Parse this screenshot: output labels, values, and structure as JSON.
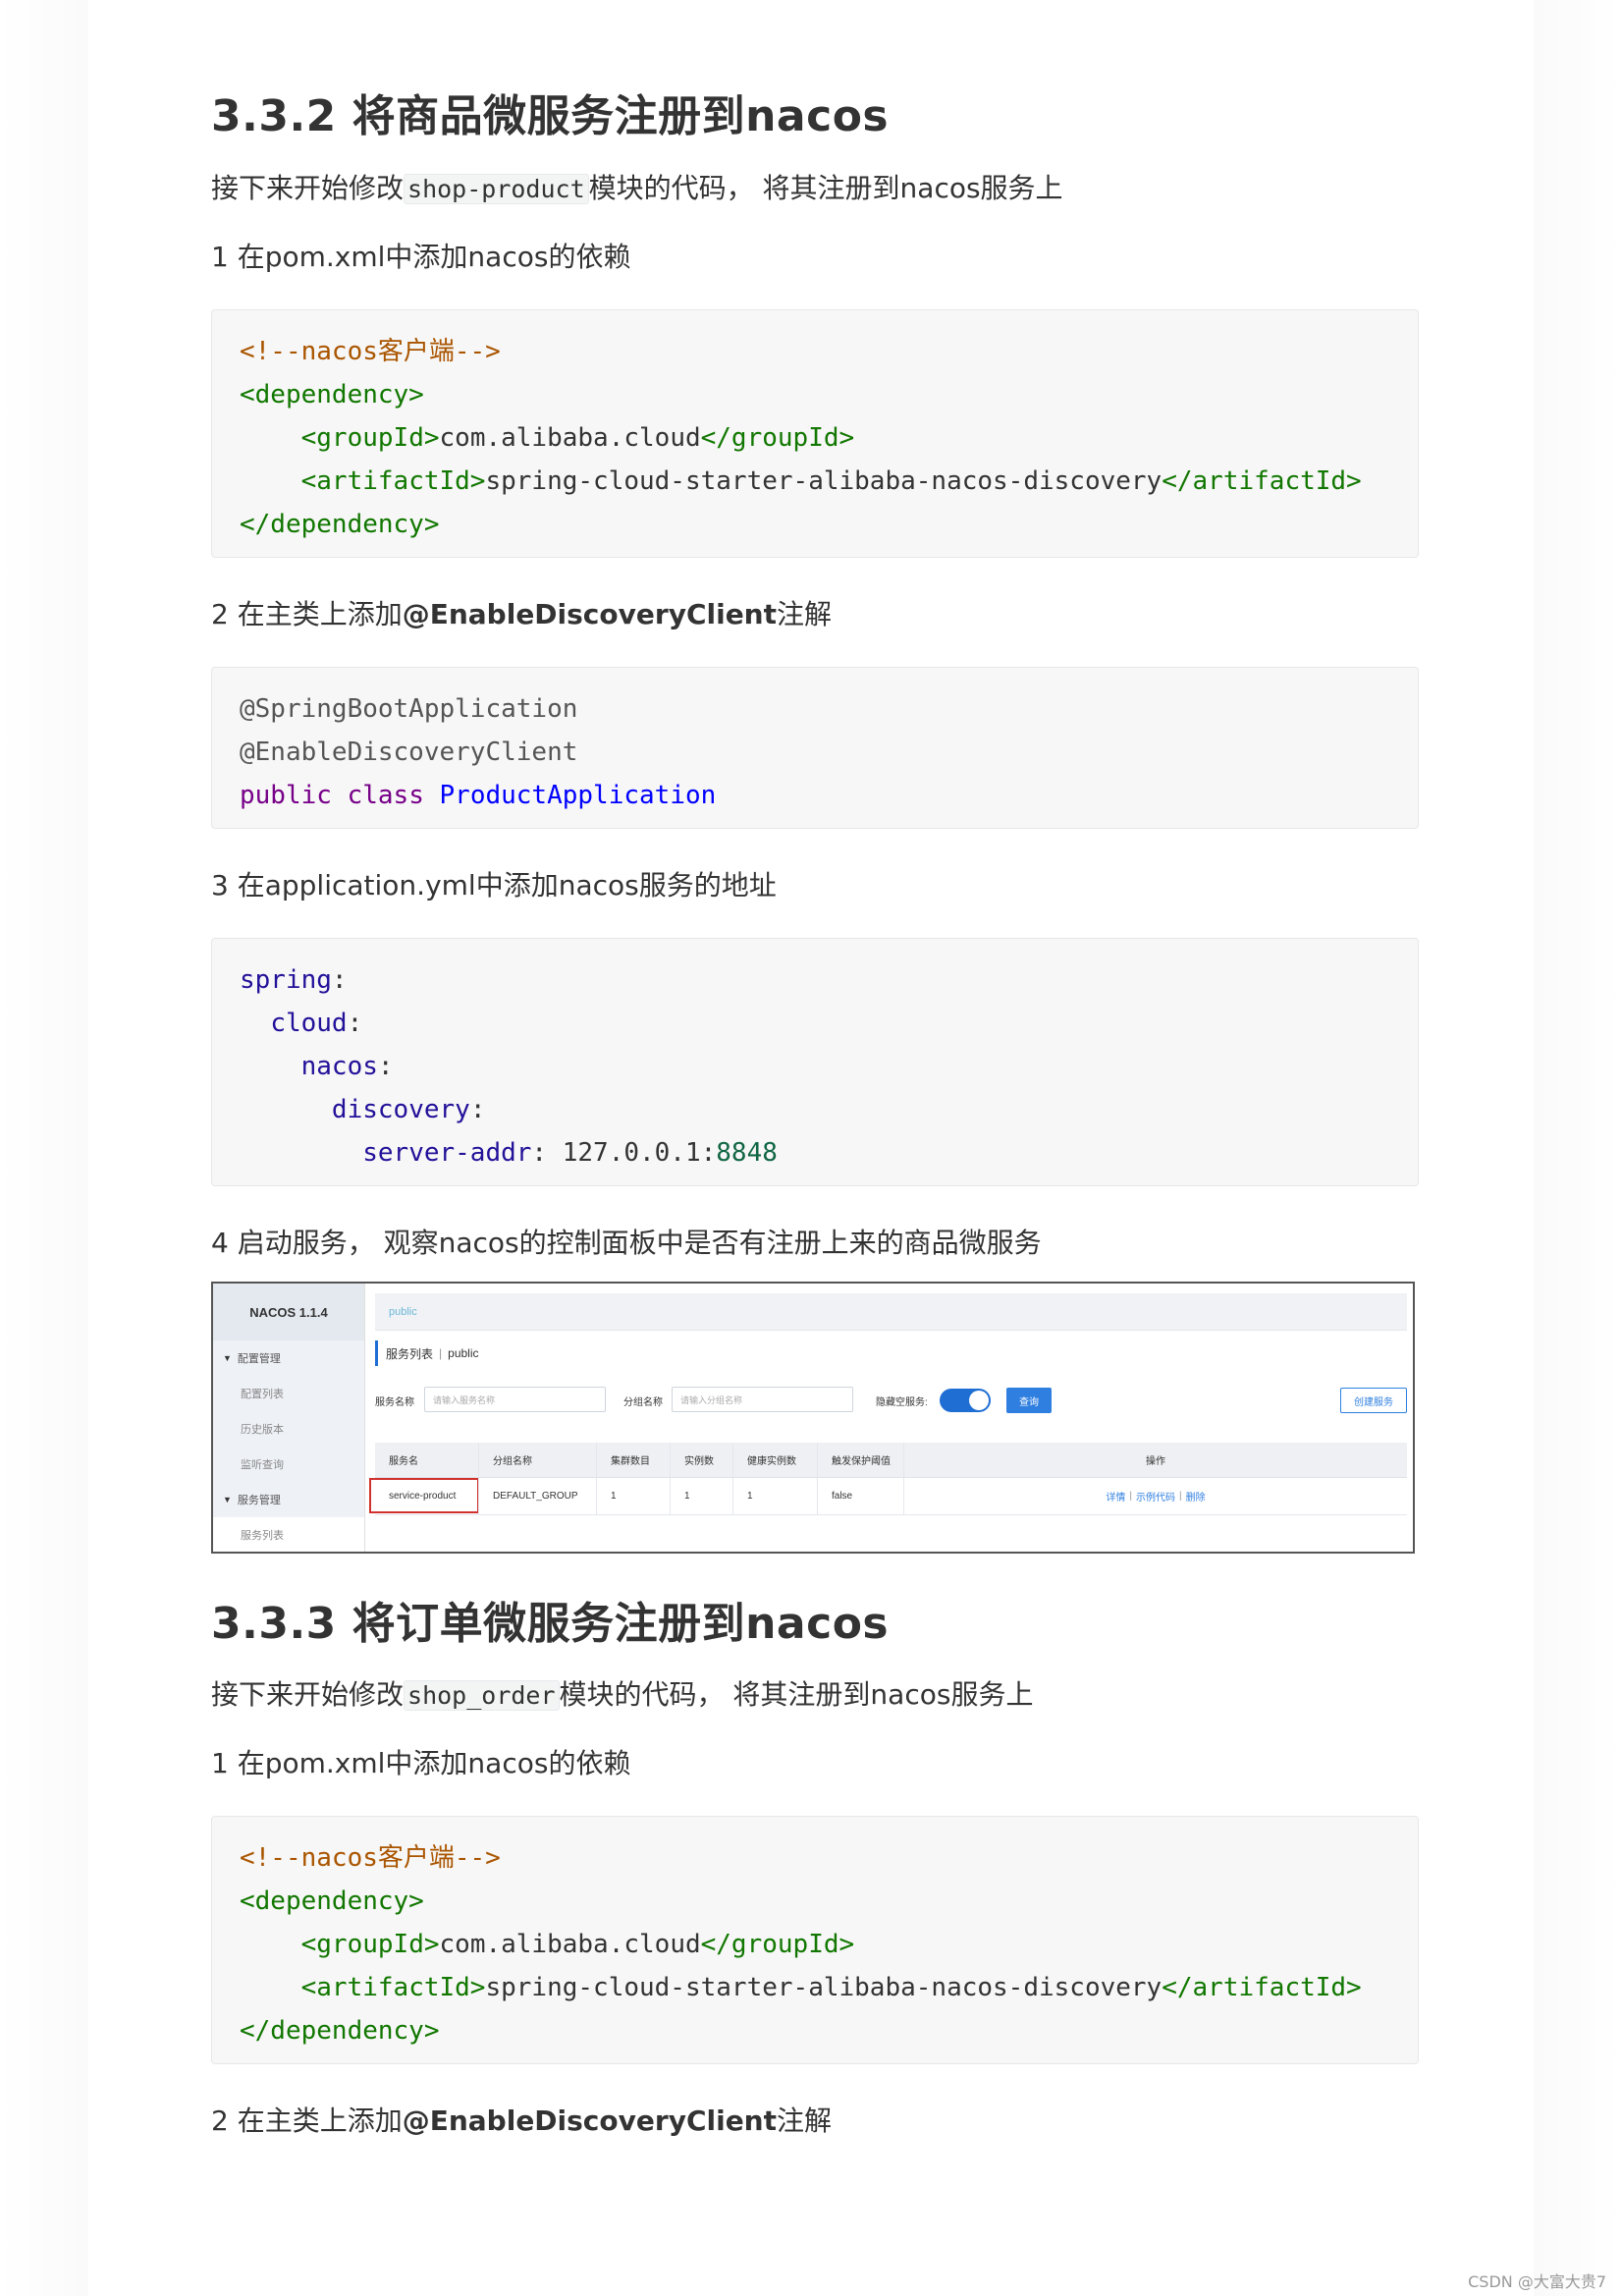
{
  "section1": {
    "heading": "3.3.2 将商品微服务注册到nacos",
    "intro_before": "接下来开始修改",
    "intro_code": "shop-product",
    "intro_after": "模块的代码， 将其注册到nacos服务上",
    "step1": "1 在pom.xml中添加nacos的依赖",
    "step2_before": "2 在主类上添加",
    "step2_bold": "@EnableDiscoveryClient",
    "step2_after": "注解",
    "step3": "3 在application.yml中添加nacos服务的地址",
    "step4": "4 启动服务， 观察nacos的控制面板中是否有注册上来的商品微服务"
  },
  "code_pom": {
    "comment": "<!--nacos客户端-->",
    "dep_open": "<dependency>",
    "group_open": "<groupId>",
    "group_val": "com.alibaba.cloud",
    "group_close": "</groupId>",
    "artifact_open": "<artifactId>",
    "artifact_val": "spring-cloud-starter-alibaba-nacos-discovery",
    "artifact_close": "</artifactId>",
    "dep_close": "</dependency>"
  },
  "code_main": {
    "anno1": "@SpringBootApplication",
    "anno2": "@EnableDiscoveryClient",
    "kw_public": "public",
    "kw_class": "class",
    "class_name": "ProductApplication"
  },
  "code_yml": {
    "spring": "spring",
    "cloud": "cloud",
    "nacos": "nacos",
    "discovery": "discovery",
    "server_addr_key": "server-addr",
    "server_ip": "127.0.0.1",
    "server_port": "8848",
    "colon": ":"
  },
  "nacos_console": {
    "logo": "NACOS 1.1.4",
    "sidebar": {
      "config_mgmt": "配置管理",
      "config_list": "配置列表",
      "history": "历史版本",
      "listen_query": "监听查询",
      "service_mgmt": "服务管理",
      "service_list": "服务列表"
    },
    "namespace": "public",
    "page_title": "服务列表",
    "page_ns": "public",
    "filters": {
      "service_name_label": "服务名称",
      "service_name_placeholder": "请输入服务名称",
      "group_label": "分组名称",
      "group_placeholder": "请输入分组名称",
      "hide_empty_label": "隐藏空服务:",
      "search_btn": "查询",
      "create_btn": "创建服务"
    },
    "columns": [
      "服务名",
      "分组名称",
      "集群数目",
      "实例数",
      "健康实例数",
      "触发保护阈值",
      "操作"
    ],
    "row": {
      "service": "service-product",
      "group": "DEFAULT_GROUP",
      "clusters": "1",
      "instances": "1",
      "healthy": "1",
      "threshold": "false",
      "op_detail": "详情",
      "op_sample": "示例代码",
      "op_delete": "删除"
    }
  },
  "section2": {
    "heading": "3.3.3 将订单微服务注册到nacos",
    "intro_before": "接下来开始修改",
    "intro_code": "shop_order",
    "intro_after": "模块的代码， 将其注册到nacos服务上",
    "step1": "1 在pom.xml中添加nacos的依赖",
    "step2_before": "2 在主类上添加",
    "step2_bold": "@EnableDiscoveryClient",
    "step2_after": "注解"
  },
  "footer": {
    "watermark": "CSDN @大富大贵7"
  },
  "colors": {
    "code_bg": "#f7f7f7",
    "xml_tag": "#117700",
    "xml_comment": "#aa5500",
    "java_keyword": "#770088",
    "java_def": "#0000ff",
    "yml_key": "#221199",
    "yml_number": "#116644",
    "nacos_primary": "#2f7fe0",
    "highlight_box": "#d0312d"
  }
}
